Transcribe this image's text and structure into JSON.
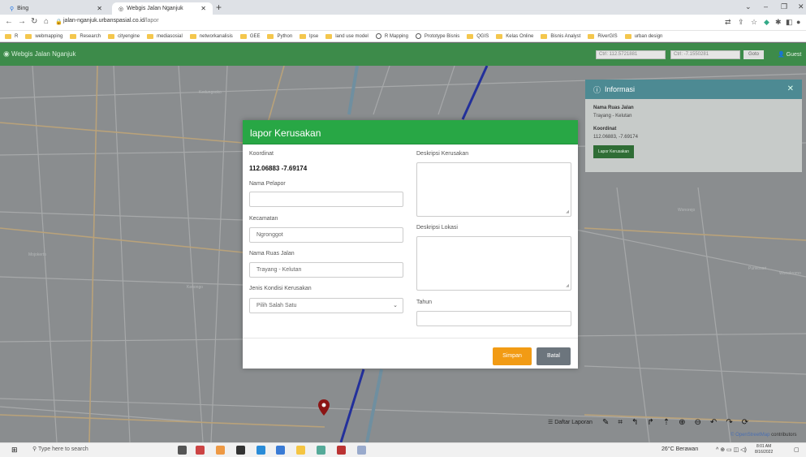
{
  "browser": {
    "tabs": [
      {
        "label": "Bing"
      },
      {
        "label": "Webgis Jalan Nganjuk"
      }
    ],
    "url_domain": "jalan-nganjuk.urbanspasial.co.id",
    "url_path": "/lapor",
    "bookmarks": [
      "R",
      "webmapping",
      "Research",
      "cityengine",
      "mediasosial",
      "networkanalisis",
      "GEE",
      "Python",
      "lpse",
      "land use model",
      "R Mapping",
      "Prototype Bisnis",
      "QGIS",
      "Kelas Online",
      "Bisnis Analyst",
      "RiverGIS",
      "urban design"
    ]
  },
  "app": {
    "brand": "Webgis Jalan Nganjuk",
    "coord_x_placeholder": "Ctrl: 112.5721881",
    "coord_y_placeholder": "Ctrl: -7.1550281",
    "goto_label": "Goto",
    "user_label": "Guest"
  },
  "info_panel": {
    "title": "Informasi",
    "road_label": "Nama Ruas Jalan",
    "road_value": "Trayang - Kelutan",
    "coord_label": "Koordinat",
    "coord_value": "112.06883, -7.69174",
    "button": "Lapor Kerusakan"
  },
  "modal": {
    "title": "lapor Kerusakan",
    "koordinat_label": "Koordinat",
    "koordinat_value": "112.06883 -7.69174",
    "pelapor_label": "Nama Pelapor",
    "pelapor_value": "",
    "kecamatan_label": "Kecamatan",
    "kecamatan_value": "Ngronggot",
    "ruas_label": "Nama Ruas Jalan",
    "ruas_value": "Trayang - Kelutan",
    "kondisi_label": "Jenis Kondisi Kerusakan",
    "kondisi_value": "Pilih Salah Satu",
    "deskripsi_label": "Deskripsi Kerusakan",
    "lokasi_label": "Deskripsi Lokasi",
    "tahun_label": "Tahun",
    "save": "Simpan",
    "cancel": "Batal"
  },
  "map": {
    "list_label": "Daftar Laporan",
    "attribution_osm": "© OpenStreetMap",
    "attribution_rest": " contributors",
    "place_labels": [
      "Wonorejo",
      "Kedungsoko",
      "Mojokerto",
      "Purwosari",
      "Kenongo",
      "Wonokromo"
    ]
  },
  "taskbar": {
    "search_placeholder": "Type here to search",
    "weather": "26°C Berawan",
    "time": "8:01 AM",
    "date": "8/16/2022"
  }
}
